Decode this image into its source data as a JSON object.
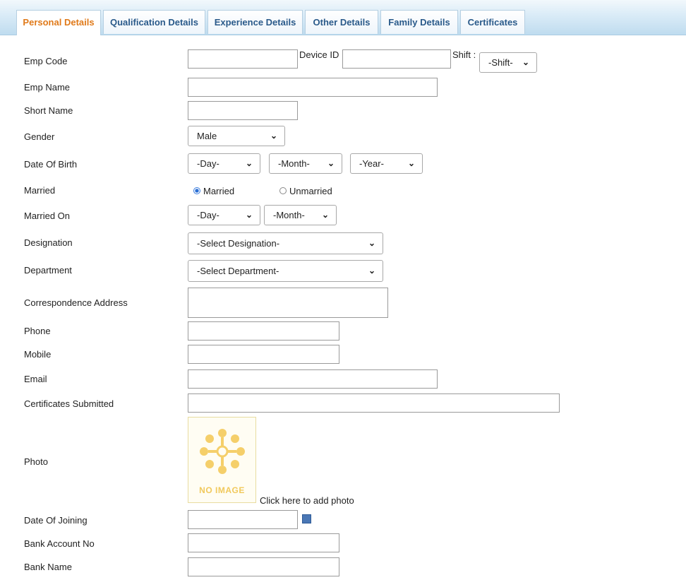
{
  "tabs": [
    {
      "label": "Personal Details",
      "active": true
    },
    {
      "label": "Qualification Details",
      "active": false
    },
    {
      "label": "Experience Details",
      "active": false
    },
    {
      "label": "Other Details",
      "active": false
    },
    {
      "label": "Family Details",
      "active": false
    },
    {
      "label": "Certificates",
      "active": false
    }
  ],
  "form": {
    "emp_code_label": "Emp Code",
    "device_id_label": "Device ID :",
    "shift_label": "Shift :",
    "shift_value": "-Shift-",
    "emp_name_label": "Emp Name",
    "short_name_label": "Short Name",
    "gender_label": "Gender",
    "gender_value": "Male",
    "dob_label": "Date Of Birth",
    "dob_day": "-Day-",
    "dob_month": "-Month-",
    "dob_year": "-Year-",
    "married_label": "Married",
    "married_option": "Married",
    "unmarried_option": "Unmarried",
    "married_on_label": "Married On",
    "married_on_day": "-Day-",
    "married_on_month": "-Month-",
    "designation_label": "Designation",
    "designation_value": "-Select Designation-",
    "department_label": "Department",
    "department_value": "-Select Department-",
    "address_label": "Correspondence Address",
    "phone_label": "Phone",
    "mobile_label": "Mobile",
    "email_label": "Email",
    "certificates_label": "Certificates Submitted",
    "photo_label": "Photo",
    "no_image_text": "NO IMAGE",
    "add_photo_text": "Click here to add photo",
    "doj_label": "Date Of Joining",
    "bank_account_label": "Bank Account No",
    "bank_name_label": "Bank Name"
  },
  "colors": {
    "active_tab": "#e07a1a",
    "tab_text": "#2a5a8a",
    "no_image": "#f1c95c"
  },
  "icons": [
    "chevron-down-icon",
    "flower-placeholder-icon",
    "calendar-icon",
    "textarea-resize-icon"
  ]
}
